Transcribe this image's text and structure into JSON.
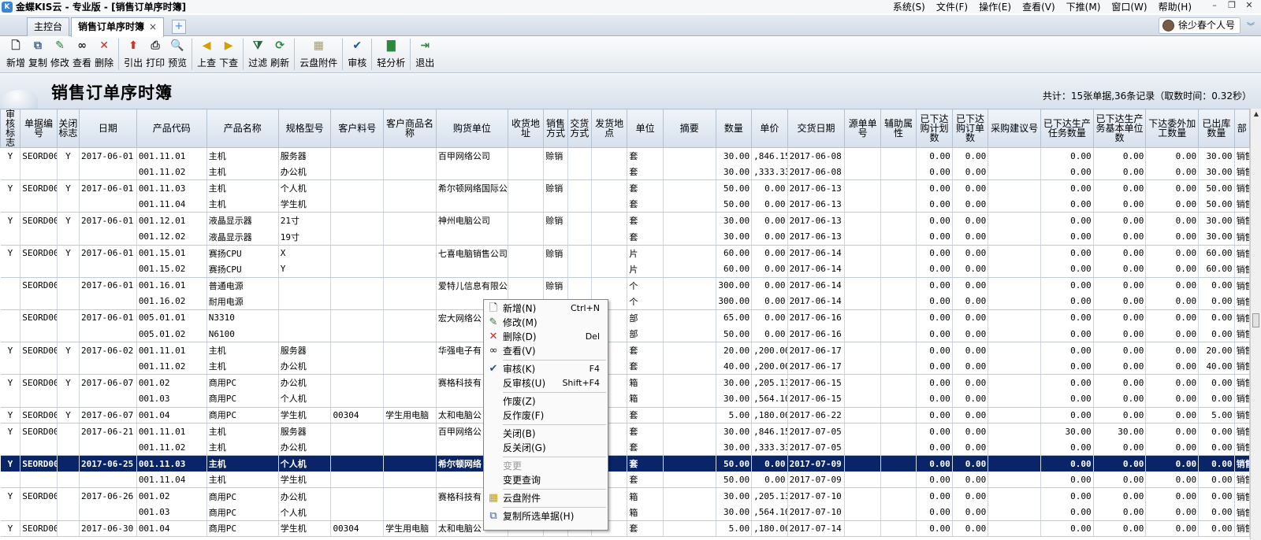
{
  "app": {
    "title": "金蝶KIS云 - 专业版 - [销售订单序时簿]",
    "menu": [
      "系统(S)",
      "文件(F)",
      "操作(E)",
      "查看(V)",
      "下推(M)",
      "窗口(W)",
      "帮助(H)"
    ]
  },
  "tabs": {
    "home": "主控台",
    "active": "销售订单序时簿",
    "close": "×",
    "add": "+"
  },
  "user": {
    "name": "徐少春个人号"
  },
  "toolbar": [
    {
      "label": "新增",
      "icon": "new-doc-icon",
      "glyph": "🗋",
      "color": "#333333"
    },
    {
      "label": "复制",
      "icon": "copy-icon",
      "glyph": "⧉",
      "color": "#3a5f9a"
    },
    {
      "label": "修改",
      "icon": "edit-icon",
      "glyph": "✎",
      "color": "#2a7a3a"
    },
    {
      "label": "查看",
      "icon": "binoculars-icon",
      "glyph": "∞",
      "color": "#222222"
    },
    {
      "label": "删除",
      "icon": "delete-x-icon",
      "glyph": "✕",
      "color": "#e02020"
    },
    {
      "sep": true
    },
    {
      "label": "引出",
      "icon": "export-icon",
      "glyph": "⬆",
      "color": "#d03020"
    },
    {
      "label": "打印",
      "icon": "printer-icon",
      "glyph": "⎙",
      "color": "#333333"
    },
    {
      "label": "预览",
      "icon": "preview-icon",
      "glyph": "🔍",
      "color": "#333333"
    },
    {
      "sep": true
    },
    {
      "label": "上查",
      "icon": "query-up-icon",
      "glyph": "◀",
      "color": "#d4a000"
    },
    {
      "label": "下查",
      "icon": "query-down-icon",
      "glyph": "▶",
      "color": "#d4a000"
    },
    {
      "sep": true
    },
    {
      "label": "过滤",
      "icon": "filter-icon",
      "glyph": "⧩",
      "color": "#2a6a3a"
    },
    {
      "label": "刷新",
      "icon": "refresh-icon",
      "glyph": "⟳",
      "color": "#2a8a3a"
    },
    {
      "sep": true
    },
    {
      "label": "云盘附件",
      "icon": "cloud-attachment-icon",
      "glyph": "▦",
      "color": "#c8a000"
    },
    {
      "sep": true
    },
    {
      "label": "审核",
      "icon": "approve-icon",
      "glyph": "✔",
      "color": "#2050a0"
    },
    {
      "sep": true
    },
    {
      "label": "轻分析",
      "icon": "bar-chart-icon",
      "glyph": "▇",
      "color": "#2a8a3a"
    },
    {
      "sep": true
    },
    {
      "label": "退出",
      "icon": "exit-icon",
      "glyph": "⇥",
      "color": "#2a8a3a"
    }
  ],
  "report": {
    "title": "销售订单序时簿",
    "summary": "共计：15张单据,36条记录（取数时间：0.32秒）"
  },
  "columns": [
    {
      "label": "审核标志",
      "w": 25
    },
    {
      "label": "单据编号",
      "w": 46
    },
    {
      "label": "关闭标志",
      "w": 28
    },
    {
      "label": "日期",
      "w": 72
    },
    {
      "label": "产品代码",
      "w": 88
    },
    {
      "label": "产品名称",
      "w": 90
    },
    {
      "label": "规格型号",
      "w": 66
    },
    {
      "label": "客户料号",
      "w": 66
    },
    {
      "label": "客户商品名称",
      "w": 66
    },
    {
      "label": "购货单位",
      "w": 90
    },
    {
      "label": "收货地址",
      "w": 45
    },
    {
      "label": "销售方式",
      "w": 30
    },
    {
      "label": "交货方式",
      "w": 30
    },
    {
      "label": "发货地点",
      "w": 45
    },
    {
      "label": "单位",
      "w": 45
    },
    {
      "label": "摘要",
      "w": 66
    },
    {
      "label": "数量",
      "w": 45
    },
    {
      "label": "单价",
      "w": 45
    },
    {
      "label": "交货日期",
      "w": 72
    },
    {
      "label": "源单单号",
      "w": 45
    },
    {
      "label": "辅助属性",
      "w": 45
    },
    {
      "label": "已下达购计划数",
      "w": 45
    },
    {
      "label": "已下达购订单数",
      "w": 45
    },
    {
      "label": "采购建议号",
      "w": 66
    },
    {
      "label": "已下达生产任务数量",
      "w": 66
    },
    {
      "label": "已下达生产务基本单位数",
      "w": 66
    },
    {
      "label": "下达委外加工数量",
      "w": 66
    },
    {
      "label": "已出库数量",
      "w": 45
    },
    {
      "label": "部",
      "w": 19
    }
  ],
  "align": [
    "c",
    "",
    "c",
    "",
    "",
    "",
    "",
    "",
    "",
    "",
    "",
    "",
    "",
    "",
    "",
    "",
    "r",
    "r",
    "",
    "",
    "",
    "r",
    "r",
    "",
    "r",
    "r",
    "r",
    "r",
    ""
  ],
  "rows": [
    {
      "g": 1,
      "c": [
        "Y",
        "SEORD00",
        "Y",
        "2017-06-01",
        "001.11.01",
        "主机",
        "服务器",
        "",
        "",
        "百甲网络公司",
        "",
        "赊销",
        "",
        "",
        "套",
        "",
        "30.00",
        ",846.15",
        "2017-06-08",
        "",
        "",
        "0.00",
        "0.00",
        "",
        "0.00",
        "0.00",
        "0.00",
        "30.00",
        "销售"
      ]
    },
    {
      "g": 1,
      "end": true,
      "c": [
        "",
        "",
        "",
        "",
        "001.11.02",
        "主机",
        "办公机",
        "",
        "",
        "",
        "",
        "",
        "",
        "",
        "套",
        "",
        "30.00",
        ",333.33",
        "2017-06-08",
        "",
        "",
        "0.00",
        "0.00",
        "",
        "0.00",
        "0.00",
        "0.00",
        "30.00",
        "销售"
      ]
    },
    {
      "g": 2,
      "c": [
        "Y",
        "SEORD00",
        "Y",
        "2017-06-01",
        "001.11.03",
        "主机",
        "个人机",
        "",
        "",
        "希尔顿网络国际公",
        "",
        "赊销",
        "",
        "",
        "套",
        "",
        "50.00",
        "0.00",
        "2017-06-13",
        "",
        "",
        "0.00",
        "0.00",
        "",
        "0.00",
        "0.00",
        "0.00",
        "50.00",
        "销售"
      ]
    },
    {
      "g": 2,
      "end": true,
      "c": [
        "",
        "",
        "",
        "",
        "001.11.04",
        "主机",
        "学生机",
        "",
        "",
        "",
        "",
        "",
        "",
        "",
        "套",
        "",
        "50.00",
        "0.00",
        "2017-06-13",
        "",
        "",
        "0.00",
        "0.00",
        "",
        "0.00",
        "0.00",
        "0.00",
        "50.00",
        "销售"
      ]
    },
    {
      "g": 3,
      "c": [
        "Y",
        "SEORD00",
        "Y",
        "2017-06-01",
        "001.12.01",
        "液晶显示器",
        "21寸",
        "",
        "",
        "神州电脑公司",
        "",
        "赊销",
        "",
        "",
        "套",
        "",
        "30.00",
        "0.00",
        "2017-06-13",
        "",
        "",
        "0.00",
        "0.00",
        "",
        "0.00",
        "0.00",
        "0.00",
        "30.00",
        "销售"
      ]
    },
    {
      "g": 3,
      "end": true,
      "c": [
        "",
        "",
        "",
        "",
        "001.12.02",
        "液晶显示器",
        "19寸",
        "",
        "",
        "",
        "",
        "",
        "",
        "",
        "套",
        "",
        "30.00",
        "0.00",
        "2017-06-13",
        "",
        "",
        "0.00",
        "0.00",
        "",
        "0.00",
        "0.00",
        "0.00",
        "30.00",
        "销售"
      ]
    },
    {
      "g": 4,
      "c": [
        "Y",
        "SEORD00",
        "Y",
        "2017-06-01",
        "001.15.01",
        "赛扬CPU",
        "X",
        "",
        "",
        "七喜电脑销售公司",
        "",
        "赊销",
        "",
        "",
        "片",
        "",
        "60.00",
        "0.00",
        "2017-06-14",
        "",
        "",
        "0.00",
        "0.00",
        "",
        "0.00",
        "0.00",
        "0.00",
        "60.00",
        "销售"
      ]
    },
    {
      "g": 4,
      "end": true,
      "c": [
        "",
        "",
        "",
        "",
        "001.15.02",
        "赛扬CPU",
        "Y",
        "",
        "",
        "",
        "",
        "",
        "",
        "",
        "片",
        "",
        "60.00",
        "0.00",
        "2017-06-14",
        "",
        "",
        "0.00",
        "0.00",
        "",
        "0.00",
        "0.00",
        "0.00",
        "60.00",
        "销售"
      ]
    },
    {
      "g": 5,
      "c": [
        "",
        "SEORD00",
        "",
        "2017-06-01",
        "001.16.01",
        "普通电源",
        "",
        "",
        "",
        "爱特儿信息有限公",
        "",
        "赊销",
        "",
        "",
        "个",
        "",
        "300.00",
        "0.00",
        "2017-06-14",
        "",
        "",
        "0.00",
        "0.00",
        "",
        "0.00",
        "0.00",
        "0.00",
        "0.00",
        "销售"
      ]
    },
    {
      "g": 5,
      "end": true,
      "c": [
        "",
        "",
        "",
        "",
        "001.16.02",
        "耐用电源",
        "",
        "",
        "",
        "",
        "",
        "",
        "",
        "",
        "个",
        "",
        "300.00",
        "0.00",
        "2017-06-14",
        "",
        "",
        "0.00",
        "0.00",
        "",
        "0.00",
        "0.00",
        "0.00",
        "0.00",
        "销售"
      ]
    },
    {
      "g": 6,
      "c": [
        "",
        "SEORD00",
        "",
        "2017-06-01",
        "005.01.01",
        "N3310",
        "",
        "",
        "",
        "宏大网络公",
        "",
        "",
        "",
        "",
        "部",
        "",
        "65.00",
        "0.00",
        "2017-06-16",
        "",
        "",
        "0.00",
        "0.00",
        "",
        "0.00",
        "0.00",
        "0.00",
        "0.00",
        "销售"
      ]
    },
    {
      "g": 6,
      "end": true,
      "c": [
        "",
        "",
        "",
        "",
        "005.01.02",
        "N6100",
        "",
        "",
        "",
        "",
        "",
        "",
        "",
        "",
        "部",
        "",
        "50.00",
        "0.00",
        "2017-06-16",
        "",
        "",
        "0.00",
        "0.00",
        "",
        "0.00",
        "0.00",
        "0.00",
        "0.00",
        "销售"
      ]
    },
    {
      "g": 7,
      "c": [
        "Y",
        "SEORD00",
        "Y",
        "2017-06-02",
        "001.11.01",
        "主机",
        "服务器",
        "",
        "",
        "华强电子有",
        "",
        "",
        "",
        "",
        "套",
        "",
        "20.00",
        ",200.00",
        "2017-06-17",
        "",
        "",
        "0.00",
        "0.00",
        "",
        "0.00",
        "0.00",
        "0.00",
        "20.00",
        "销售"
      ]
    },
    {
      "g": 7,
      "end": true,
      "c": [
        "",
        "",
        "",
        "",
        "001.11.02",
        "主机",
        "办公机",
        "",
        "",
        "",
        "",
        "",
        "",
        "",
        "套",
        "",
        "40.00",
        ",200.00",
        "2017-06-17",
        "",
        "",
        "0.00",
        "0.00",
        "",
        "0.00",
        "0.00",
        "0.00",
        "40.00",
        "销售"
      ]
    },
    {
      "g": 8,
      "c": [
        "Y",
        "SEORD00",
        "Y",
        "2017-06-07",
        "001.02",
        "商用PC",
        "办公机",
        "",
        "",
        "赛格科技有",
        "",
        "",
        "",
        "",
        "箱",
        "",
        "30.00",
        ",205.13",
        "2017-06-15",
        "",
        "",
        "0.00",
        "0.00",
        "",
        "0.00",
        "0.00",
        "0.00",
        "0.00",
        "销售"
      ]
    },
    {
      "g": 8,
      "end": true,
      "c": [
        "",
        "",
        "",
        "",
        "001.03",
        "商用PC",
        "个人机",
        "",
        "",
        "",
        "",
        "",
        "",
        "",
        "箱",
        "",
        "30.00",
        ",564.10",
        "2017-06-15",
        "",
        "",
        "0.00",
        "0.00",
        "",
        "0.00",
        "0.00",
        "0.00",
        "0.00",
        "销售"
      ]
    },
    {
      "g": 9,
      "end": true,
      "c": [
        "Y",
        "SEORD00",
        "Y",
        "2017-06-07",
        "001.04",
        "商用PC",
        "学生机",
        "00304",
        "学生用电脑",
        "太和电脑公",
        "",
        "",
        "",
        "",
        "套",
        "",
        "5.00",
        ",180.00",
        "2017-06-22",
        "",
        "",
        "0.00",
        "0.00",
        "",
        "0.00",
        "0.00",
        "0.00",
        "5.00",
        "销售"
      ]
    },
    {
      "g": 10,
      "c": [
        "Y",
        "SEORD00",
        "",
        "2017-06-21",
        "001.11.01",
        "主机",
        "服务器",
        "",
        "",
        "百甲网络公",
        "",
        "",
        "",
        "",
        "套",
        "",
        "30.00",
        ",846.15",
        "2017-07-05",
        "",
        "",
        "0.00",
        "0.00",
        "",
        "30.00",
        "30.00",
        "0.00",
        "0.00",
        "销售"
      ]
    },
    {
      "g": 10,
      "end": true,
      "c": [
        "",
        "",
        "",
        "",
        "001.11.02",
        "主机",
        "办公机",
        "",
        "",
        "",
        "",
        "",
        "",
        "",
        "套",
        "",
        "30.00",
        ",333.33",
        "2017-07-05",
        "",
        "",
        "0.00",
        "0.00",
        "",
        "0.00",
        "0.00",
        "0.00",
        "0.00",
        "销售"
      ]
    },
    {
      "g": 11,
      "sel": true,
      "c": [
        "Y",
        "SEORD00",
        "",
        "2017-06-25",
        "001.11.03",
        "主机",
        "个人机",
        "",
        "",
        "希尔顿网络",
        "",
        "",
        "",
        "",
        "套",
        "",
        "50.00",
        "0.00",
        "2017-07-09",
        "",
        "",
        "0.00",
        "0.00",
        "",
        "0.00",
        "0.00",
        "0.00",
        "0.00",
        "销售"
      ]
    },
    {
      "g": 11,
      "end": true,
      "c": [
        "",
        "",
        "",
        "",
        "001.11.04",
        "主机",
        "学生机",
        "",
        "",
        "",
        "",
        "",
        "",
        "",
        "套",
        "",
        "50.00",
        "0.00",
        "2017-07-09",
        "",
        "",
        "0.00",
        "0.00",
        "",
        "0.00",
        "0.00",
        "0.00",
        "0.00",
        "销售"
      ]
    },
    {
      "g": 12,
      "c": [
        "Y",
        "SEORD00",
        "",
        "2017-06-26",
        "001.02",
        "商用PC",
        "办公机",
        "",
        "",
        "赛格科技有",
        "",
        "",
        "",
        "",
        "箱",
        "",
        "30.00",
        ",205.13",
        "2017-07-10",
        "",
        "",
        "0.00",
        "0.00",
        "",
        "0.00",
        "0.00",
        "0.00",
        "0.00",
        "销售"
      ]
    },
    {
      "g": 12,
      "end": true,
      "c": [
        "",
        "",
        "",
        "",
        "001.03",
        "商用PC",
        "个人机",
        "",
        "",
        "",
        "",
        "",
        "",
        "",
        "箱",
        "",
        "30.00",
        ",564.10",
        "2017-07-10",
        "",
        "",
        "0.00",
        "0.00",
        "",
        "0.00",
        "0.00",
        "0.00",
        "0.00",
        "销售"
      ]
    },
    {
      "g": 13,
      "end": true,
      "c": [
        "Y",
        "SEORD00",
        "",
        "2017-06-30",
        "001.04",
        "商用PC",
        "学生机",
        "00304",
        "学生用电脑",
        "太和电脑公",
        "",
        "",
        "",
        "",
        "套",
        "",
        "5.00",
        ",180.00",
        "2017-07-14",
        "",
        "",
        "0.00",
        "0.00",
        "",
        "0.00",
        "0.00",
        "0.00",
        "0.00",
        "销售"
      ]
    }
  ],
  "context_menu": [
    {
      "label": "新增(N)",
      "key": "Ctrl+N",
      "icon": "new-doc-icon",
      "glyph": "🗋",
      "color": "#333"
    },
    {
      "label": "修改(M)",
      "key": "",
      "icon": "edit-icon",
      "glyph": "✎",
      "color": "#2a7a3a"
    },
    {
      "label": "删除(D)",
      "key": "Del",
      "icon": "delete-x-icon",
      "glyph": "✕",
      "color": "#e02020"
    },
    {
      "label": "查看(V)",
      "key": "",
      "icon": "binoculars-icon",
      "glyph": "∞",
      "color": "#222"
    },
    {
      "sep": true
    },
    {
      "label": "审核(K)",
      "key": "F4",
      "icon": "approve-icon",
      "glyph": "✔",
      "color": "#2050a0"
    },
    {
      "label": "反审核(U)",
      "key": "Shift+F4",
      "icon": "",
      "glyph": "",
      "color": ""
    },
    {
      "sep": true
    },
    {
      "label": "作废(Z)",
      "key": "",
      "icon": "",
      "glyph": "",
      "color": ""
    },
    {
      "label": "反作废(F)",
      "key": "",
      "icon": "",
      "glyph": "",
      "color": ""
    },
    {
      "sep": true
    },
    {
      "label": "关闭(B)",
      "key": "",
      "icon": "",
      "glyph": "",
      "color": ""
    },
    {
      "label": "反关闭(G)",
      "key": "",
      "icon": "",
      "glyph": "",
      "color": ""
    },
    {
      "sep": true
    },
    {
      "label": "变更",
      "key": "",
      "icon": "",
      "glyph": "",
      "color": "",
      "disabled": true
    },
    {
      "label": "变更查询",
      "key": "",
      "icon": "",
      "glyph": "",
      "color": ""
    },
    {
      "sep": true
    },
    {
      "label": "云盘附件",
      "key": "",
      "icon": "cloud-attachment-icon",
      "glyph": "▦",
      "color": "#c8a000"
    },
    {
      "sep": true
    },
    {
      "label": "复制所选单据(H)",
      "key": "",
      "icon": "copy-icon",
      "glyph": "⧉",
      "color": "#3a5f9a"
    }
  ],
  "colors": {
    "selected_row": "#0a246a",
    "header_bg": "#d6e0ec"
  }
}
